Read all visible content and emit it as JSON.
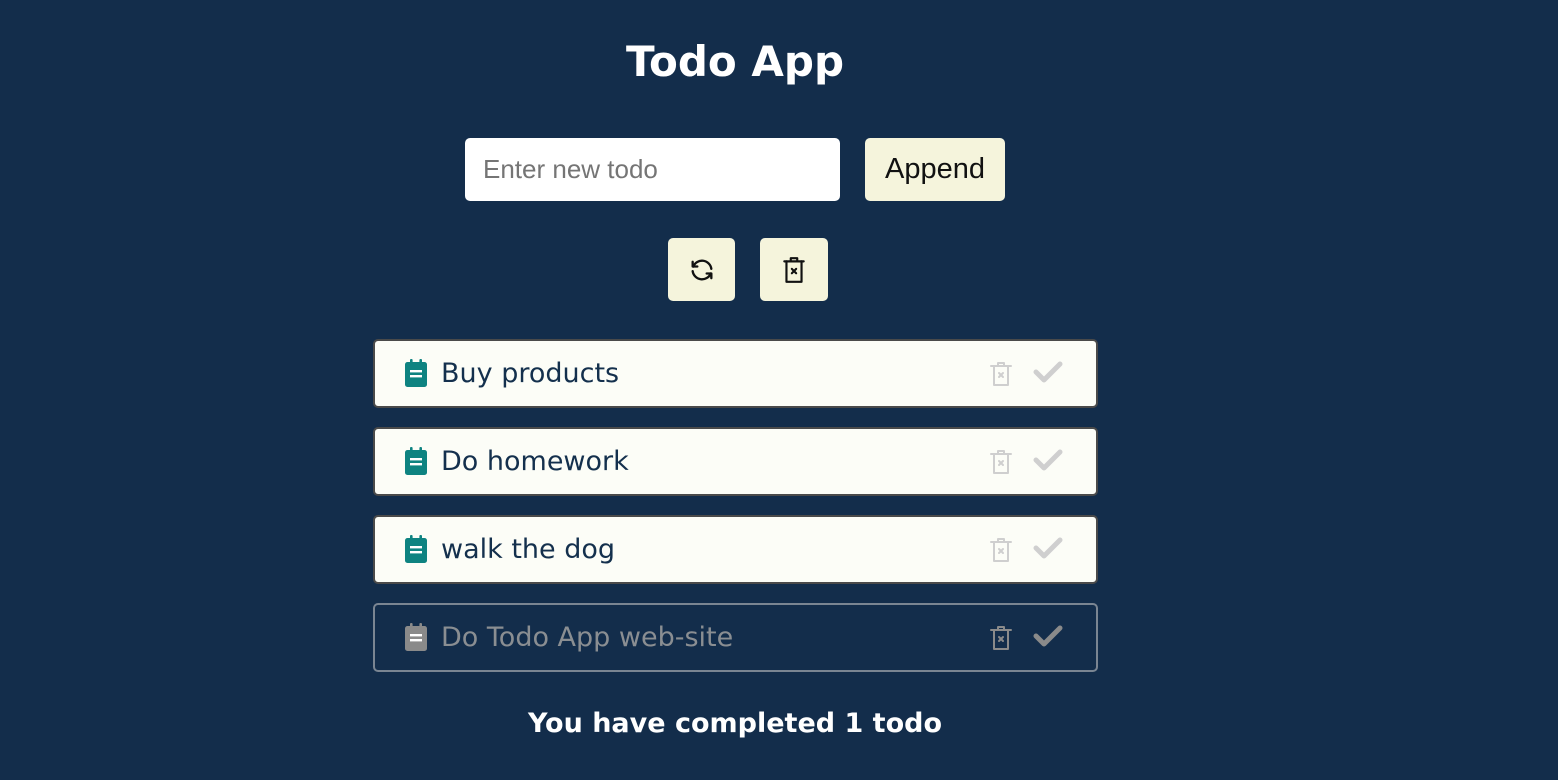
{
  "app": {
    "title": "Todo App"
  },
  "new_todo": {
    "placeholder": "Enter new todo",
    "value": "",
    "append_label": "Append"
  },
  "toolbar": {
    "refresh_icon": "refresh-icon",
    "clear_all_icon": "trash-x-icon"
  },
  "todos": [
    {
      "text": "Buy products",
      "completed": false
    },
    {
      "text": "Do homework",
      "completed": false
    },
    {
      "text": "walk the dog",
      "completed": false
    },
    {
      "text": "Do Todo App web-site",
      "completed": true
    }
  ],
  "status_text": "You have completed 1 todo",
  "colors": {
    "background": "#132d4b",
    "button_bg": "#f5f4dc",
    "note_icon_active": "#0e8381",
    "note_icon_done": "#8a8a8a",
    "item_action_icon": "#cfcfcf"
  }
}
